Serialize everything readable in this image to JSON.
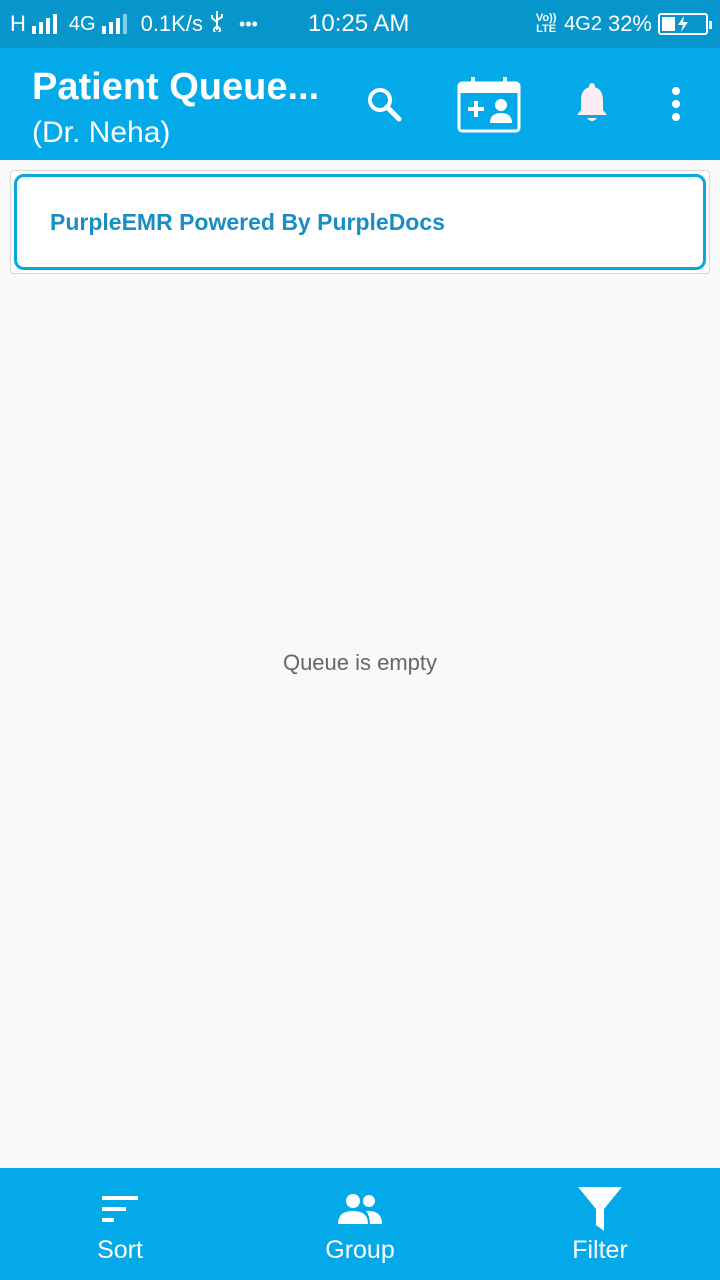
{
  "status_bar": {
    "network_left": "H",
    "network_mid": "4G",
    "speed": "0.1K/s",
    "usb_icon": "usb-icon",
    "dots": "•••",
    "time": "10:25 AM",
    "volte": "Vo)) LTE",
    "network_right": "4G2",
    "battery_percent": "32%",
    "battery_level": 0.32
  },
  "app_bar": {
    "title": "Patient Queue...",
    "subtitle": "(Dr. Neha)",
    "actions": [
      "search-icon",
      "add-appointment-icon",
      "bell-icon",
      "more-vert-icon"
    ]
  },
  "banner": {
    "text": "PurpleEMR Powered By PurpleDocs"
  },
  "main": {
    "empty_text": "Queue is empty"
  },
  "bottom_nav": {
    "items": [
      {
        "label": "Sort",
        "icon": "sort-icon"
      },
      {
        "label": "Group",
        "icon": "group-icon"
      },
      {
        "label": "Filter",
        "icon": "filter-icon"
      }
    ]
  },
  "colors": {
    "status_bar": "#0696cc",
    "app_bar": "#04a9e9",
    "banner_border": "#0aa6de",
    "banner_text": "#1a8ec4",
    "background": "#f9f9f9"
  }
}
